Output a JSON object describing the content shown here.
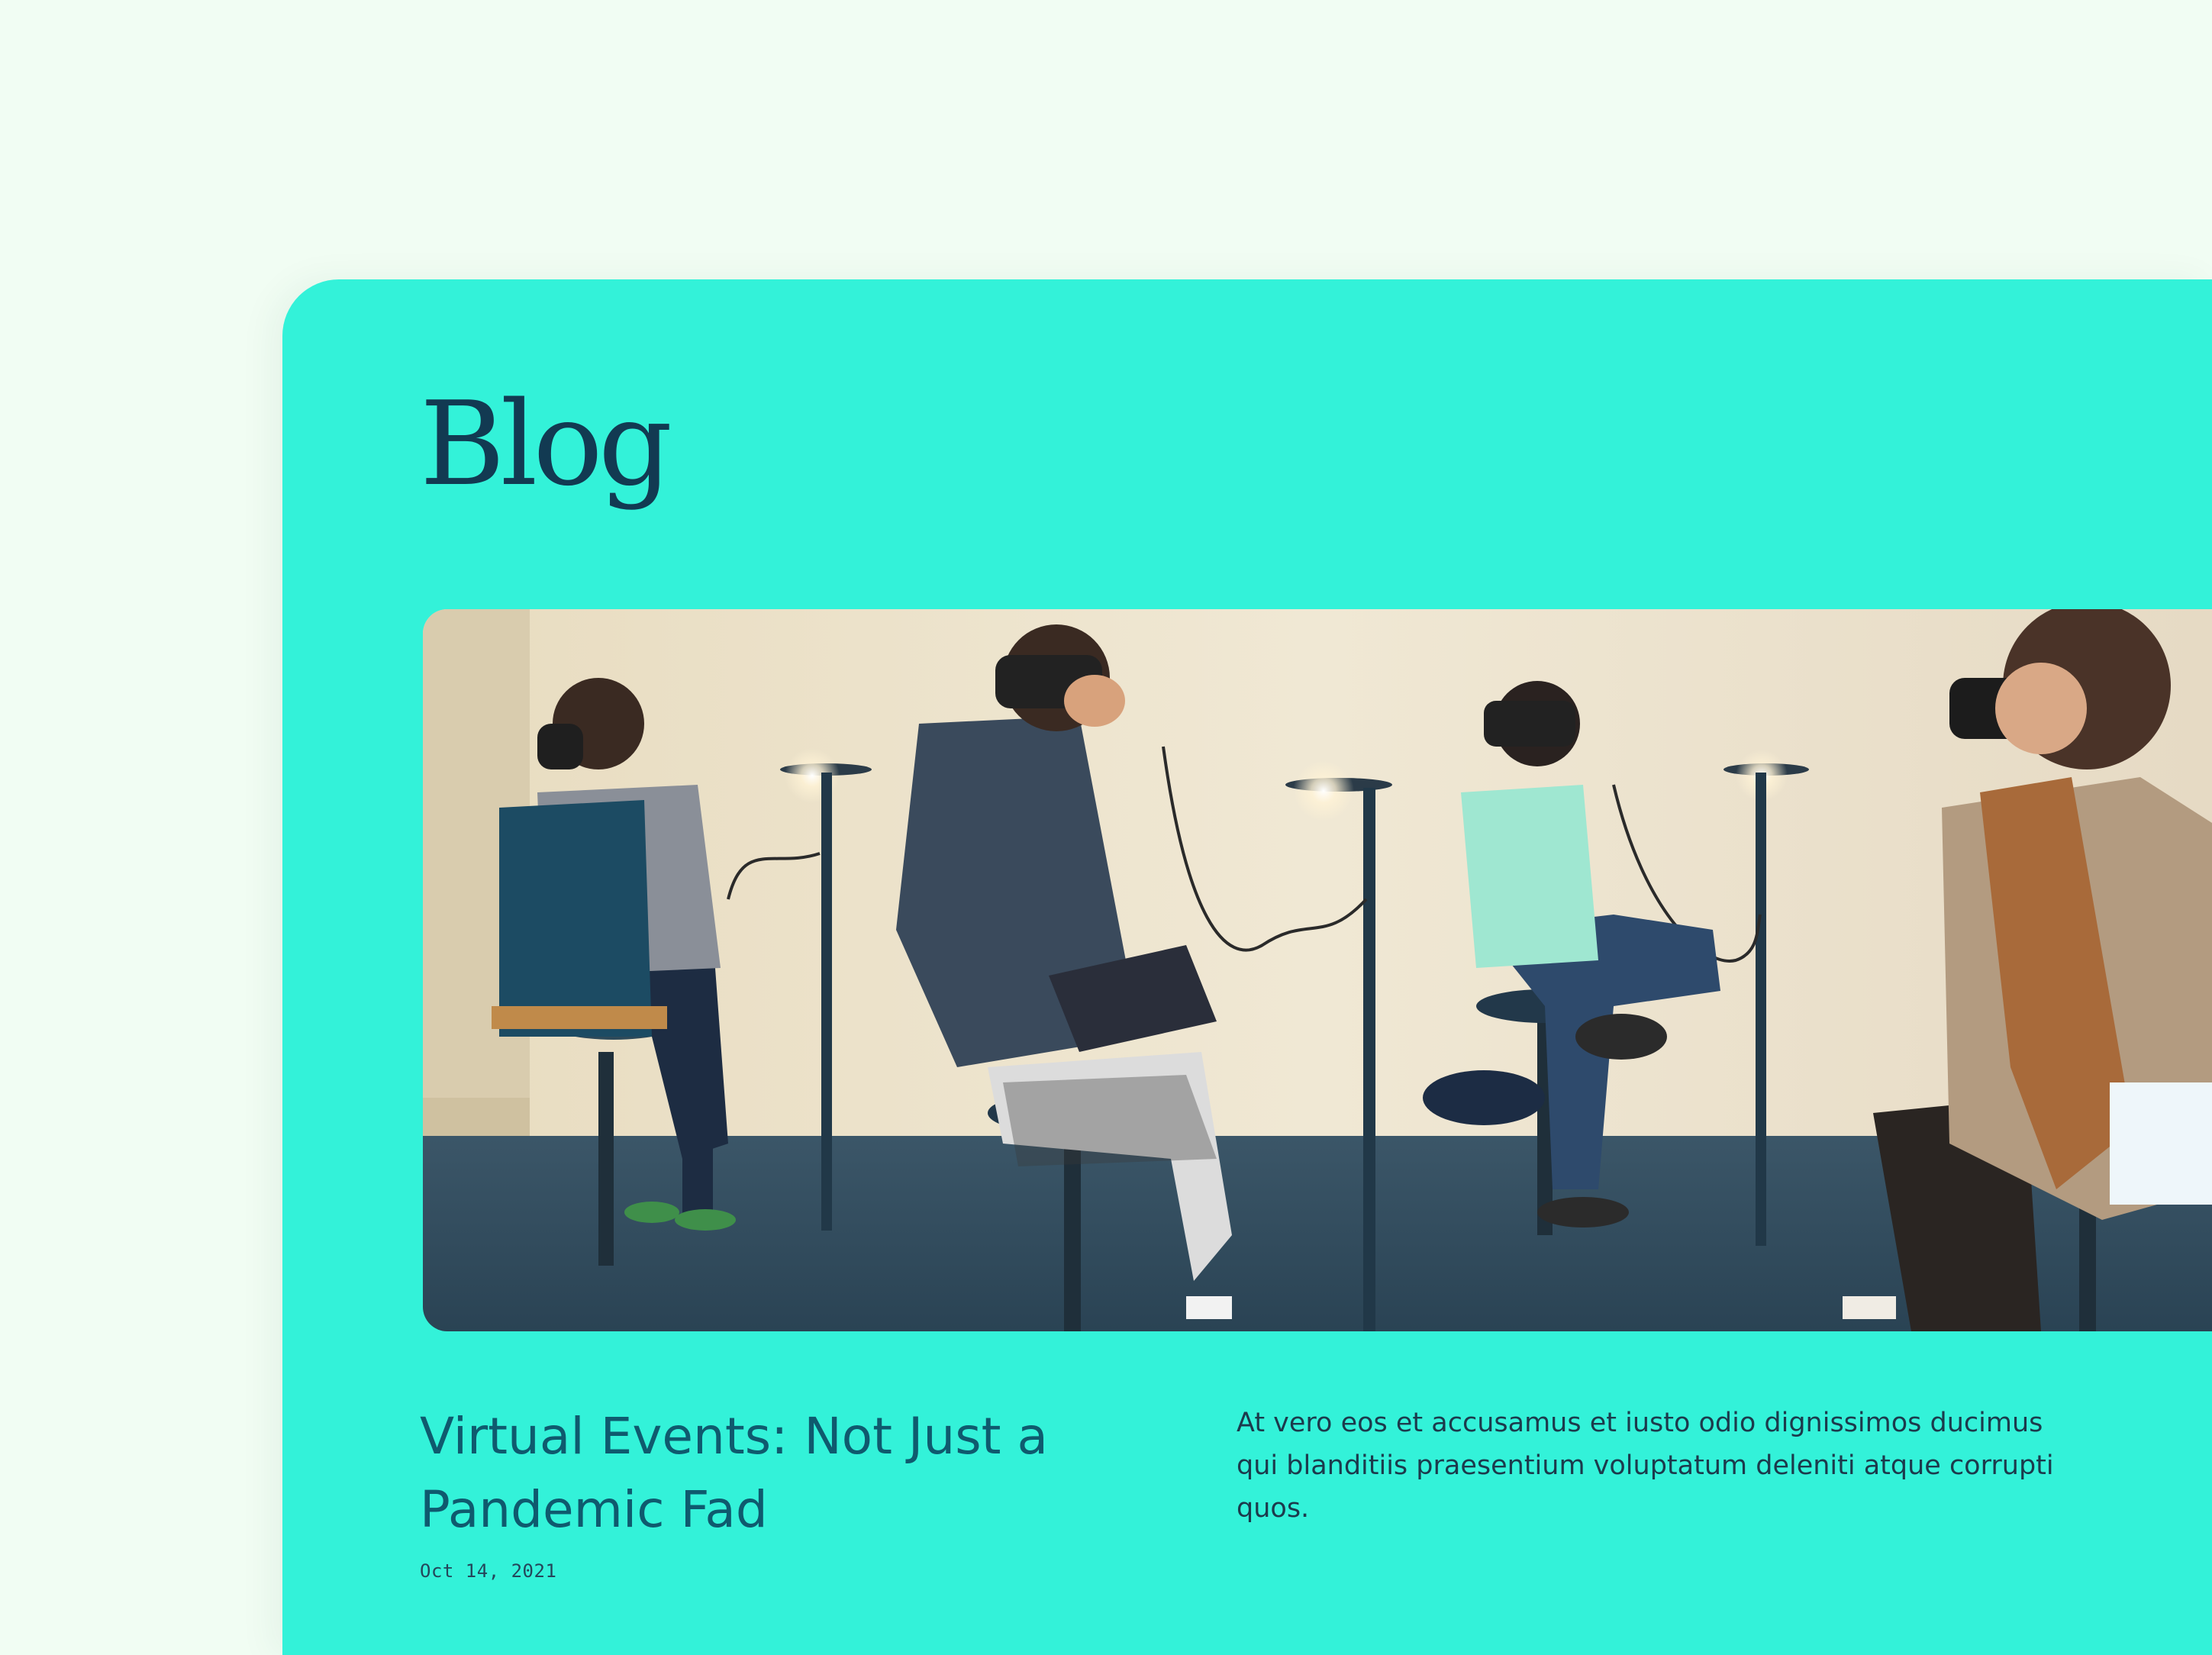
{
  "blog": {
    "title": "Blog"
  },
  "post": {
    "title": "Virtual Events: Not Just a Pandemic Fad",
    "date": "Oct 14, 2021",
    "excerpt": "At vero eos et accusamus et iusto odio dignissimos ducimus qui blanditiis praesentium voluptatum deleniti atque corrupti quos."
  },
  "colors": {
    "page_background": "#f1fdf3",
    "card_background": "#33f2d9",
    "heading": "#123a52",
    "post_title": "#0f5a6e",
    "body_text": "#1c3a4c"
  }
}
